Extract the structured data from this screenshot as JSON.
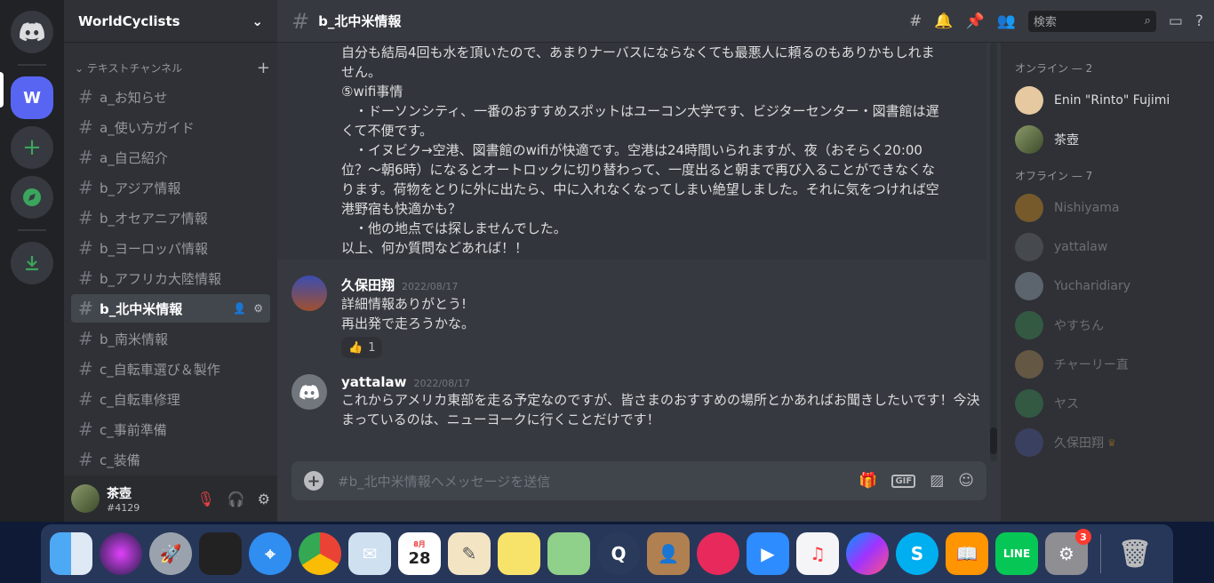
{
  "server": {
    "name": "WorldCyclists",
    "active_initial": "W"
  },
  "sidebar": {
    "category": "テキストチャンネル",
    "channels": [
      {
        "label": "a_お知らせ"
      },
      {
        "label": "a_使い方ガイド"
      },
      {
        "label": "a_自己紹介"
      },
      {
        "label": "b_アジア情報"
      },
      {
        "label": "b_オセアニア情報"
      },
      {
        "label": "b_ヨーロッパ情報"
      },
      {
        "label": "b_アフリカ大陸情報"
      },
      {
        "label": "b_北中米情報"
      },
      {
        "label": "b_南米情報"
      },
      {
        "label": "c_自転車選び＆製作"
      },
      {
        "label": "c_自転車修理"
      },
      {
        "label": "c_事前準備"
      },
      {
        "label": "c_装備"
      }
    ]
  },
  "user": {
    "name": "茶壺",
    "discriminator": "#4129"
  },
  "header": {
    "channel": "b_北中米情報",
    "search_placeholder": "検索"
  },
  "messages": {
    "continued_lines": [
      "自分も結局4回も水を頂いたので、あまりナーバスにならなくても最悪人に頼るのもありかもしれません。",
      "⑤wifi事情",
      "　・ドーソンシティ、一番のおすすめスポットはユーコン大学です、ビジターセンター・図書館は遅くて不便です。",
      "　・イヌビク→空港、図書館のwifiが快適です。空港は24時間いられますが、夜（おそらく20:00位？〜朝6時）になるとオートロックに切り替わって、一度出ると朝まで再び入ることができなくなります。荷物をとりに外に出たら、中に入れなくなってしまい絶望しました。それに気をつければ空港野宿も快適かも？",
      "　・他の地点では探しませんでした。",
      "以上、何か質問などあれば！！"
    ],
    "items": [
      {
        "author": "久保田翔",
        "timestamp": "2022/08/17",
        "line1": "詳細情報ありがとう!",
        "line2": "再出発で走ろうかな。",
        "reaction_emoji": "👍",
        "reaction_count": "1"
      },
      {
        "author": "yattalaw",
        "timestamp": "2022/08/17",
        "line1": "これからアメリカ東部を走る予定なのですが、皆さまのおすすめの場所とかあればお聞きしたいです！今決まっているのは、ニューヨークに行くことだけです！"
      }
    ]
  },
  "composer": {
    "placeholder": "#b_北中米情報へメッセージを送信",
    "gif_label": "GIF"
  },
  "members": {
    "online_label": "オンライン — 2",
    "online": [
      {
        "name": "Enin \"Rinto\" Fujimi"
      },
      {
        "name": "茶壺"
      }
    ],
    "offline_label": "オフライン — 7",
    "offline": [
      {
        "name": "Nishiyama"
      },
      {
        "name": "yattalaw"
      },
      {
        "name": "Yucharidiary"
      },
      {
        "name": "やすちん"
      },
      {
        "name": "チャーリー直"
      },
      {
        "name": "ヤス"
      },
      {
        "name": "久保田翔"
      }
    ]
  },
  "dock": {
    "calendar_month": "8月",
    "calendar_day": "28",
    "settings_badge": "3"
  }
}
